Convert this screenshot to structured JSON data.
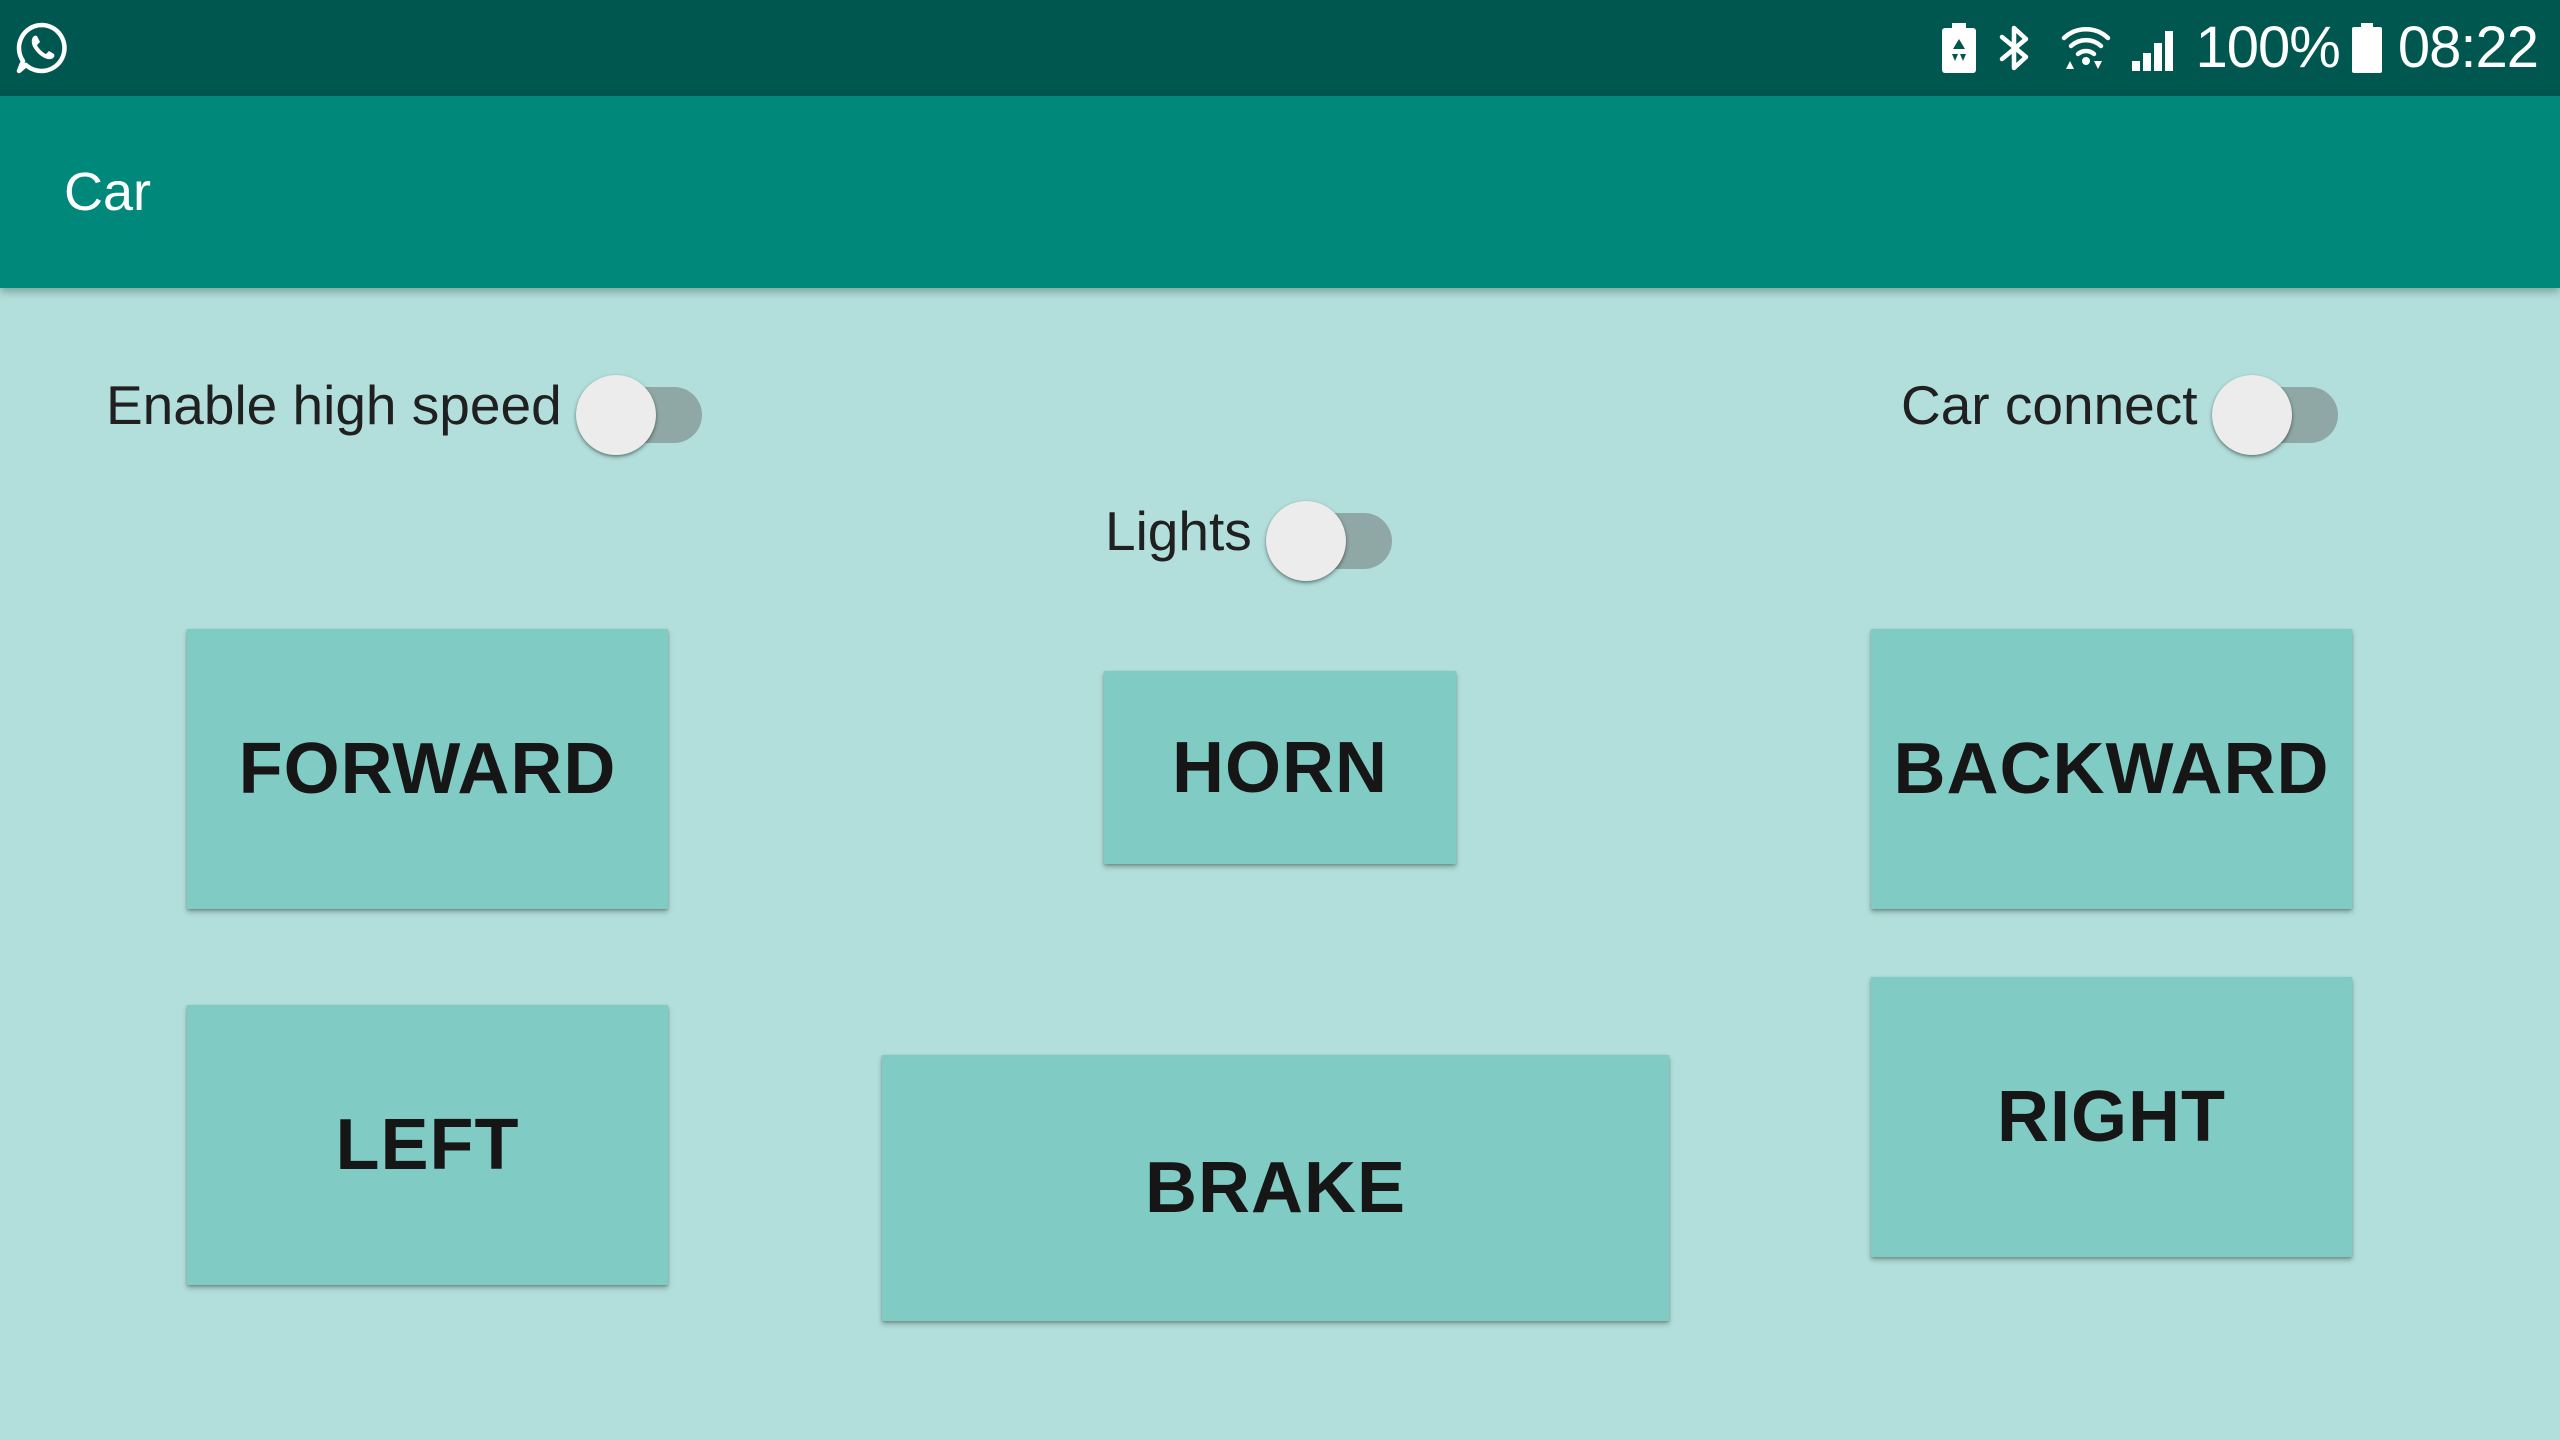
{
  "status_bar": {
    "left_icon": "whatsapp-icon",
    "icons": [
      "battery-saver-icon",
      "bluetooth-icon",
      "wifi-icon",
      "cell-signal-icon",
      "battery-icon"
    ],
    "battery_percent": "100%",
    "time": "08:22",
    "colors": {
      "background": "#00574f",
      "foreground": "#ffffff"
    }
  },
  "app_bar": {
    "title": "Car",
    "color": "#00897b"
  },
  "switches": {
    "high_speed": {
      "label": "Enable high speed",
      "checked": false
    },
    "car_connect": {
      "label": "Car connect",
      "checked": false
    },
    "lights": {
      "label": "Lights",
      "checked": false
    }
  },
  "buttons": {
    "forward": "FORWARD",
    "horn": "HORN",
    "backward": "BACKWARD",
    "left": "LEFT",
    "brake": "BRAKE",
    "right": "RIGHT"
  },
  "colors": {
    "background": "#b2dfdb",
    "button": "#80cbc4",
    "switch_track_off": "#8fa8a5",
    "switch_thumb_off": "#ececec"
  }
}
